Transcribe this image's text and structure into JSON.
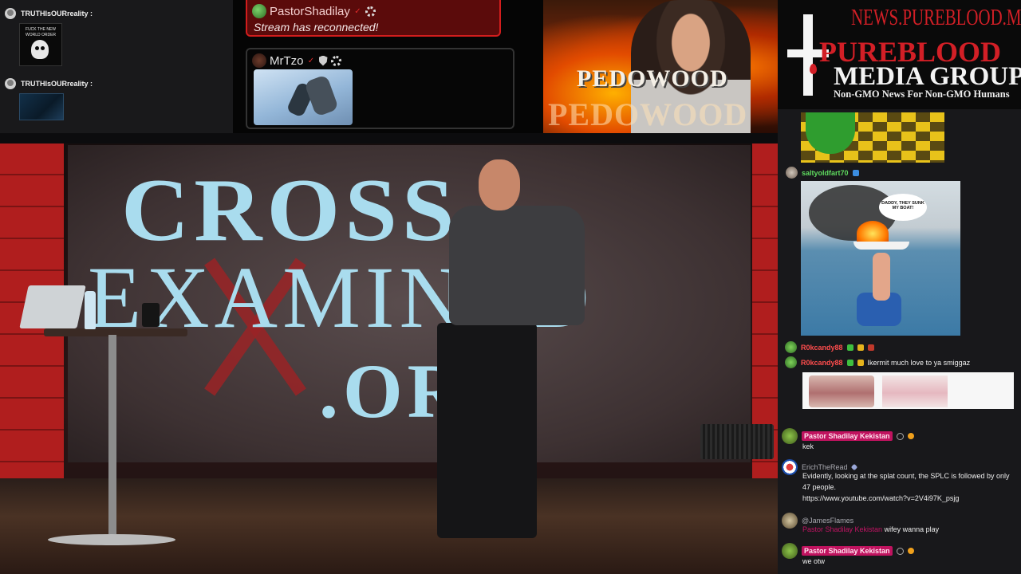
{
  "top_left_chat": {
    "messages": [
      {
        "user": "TRUTHIsOURreality :",
        "image_text": "FUCK THE NEW WORLD ORDER"
      },
      {
        "user": "TRUTHIsOURreality :"
      }
    ]
  },
  "overlay_chat": {
    "message1": {
      "user": "PastorShadilay",
      "text": "Stream has reconnected!"
    },
    "message2": {
      "user": "MrTzo"
    }
  },
  "top_right_image": {
    "caption_main": "PEDOWOOD",
    "caption_ghost": "PEDOWOOD"
  },
  "brand": {
    "url": "NEWS.PUREBLOOD.MEDIA",
    "name_line1": "PUREBLOOD",
    "name_line2": "MEDIA GROUP",
    "tagline": "Non-GMO News For Non-GMO Humans"
  },
  "right_chat": {
    "saltyoldfart": {
      "user": "saltyoldfart70"
    },
    "boat_bubble": "DADDY, THEY SUNK MY BOAT!",
    "rok1": {
      "user": "R0kcandy88"
    },
    "rok2": {
      "user": "R0kcandy88",
      "text": "Ikermit much love to ya smiggaz"
    },
    "messages": [
      {
        "user": "Pastor Shadilay Kekistan",
        "text": "kek"
      },
      {
        "user": "ErichTheRead",
        "text": "Evidently, looking at the splat count, the SPLC is followed by only 47 people.",
        "link": "https://www.youtube.com/watch?v=2V4i97K_psjg"
      },
      {
        "user": "@JamesFlames",
        "mention": "Pastor Shadilay Kekistan",
        "text": "wifey wanna play"
      },
      {
        "user": "Pastor Shadilay Kekistan",
        "text": "we otw"
      }
    ]
  },
  "video": {
    "screen_line1": "CROSS",
    "screen_line2": "EXAMINED",
    "screen_line3": ".ORG"
  },
  "colors": {
    "accent_red": "#d21d1d",
    "pill_pink": "#c0135f",
    "username_green": "#5fdb5f",
    "username_red": "#ff4d4d"
  }
}
